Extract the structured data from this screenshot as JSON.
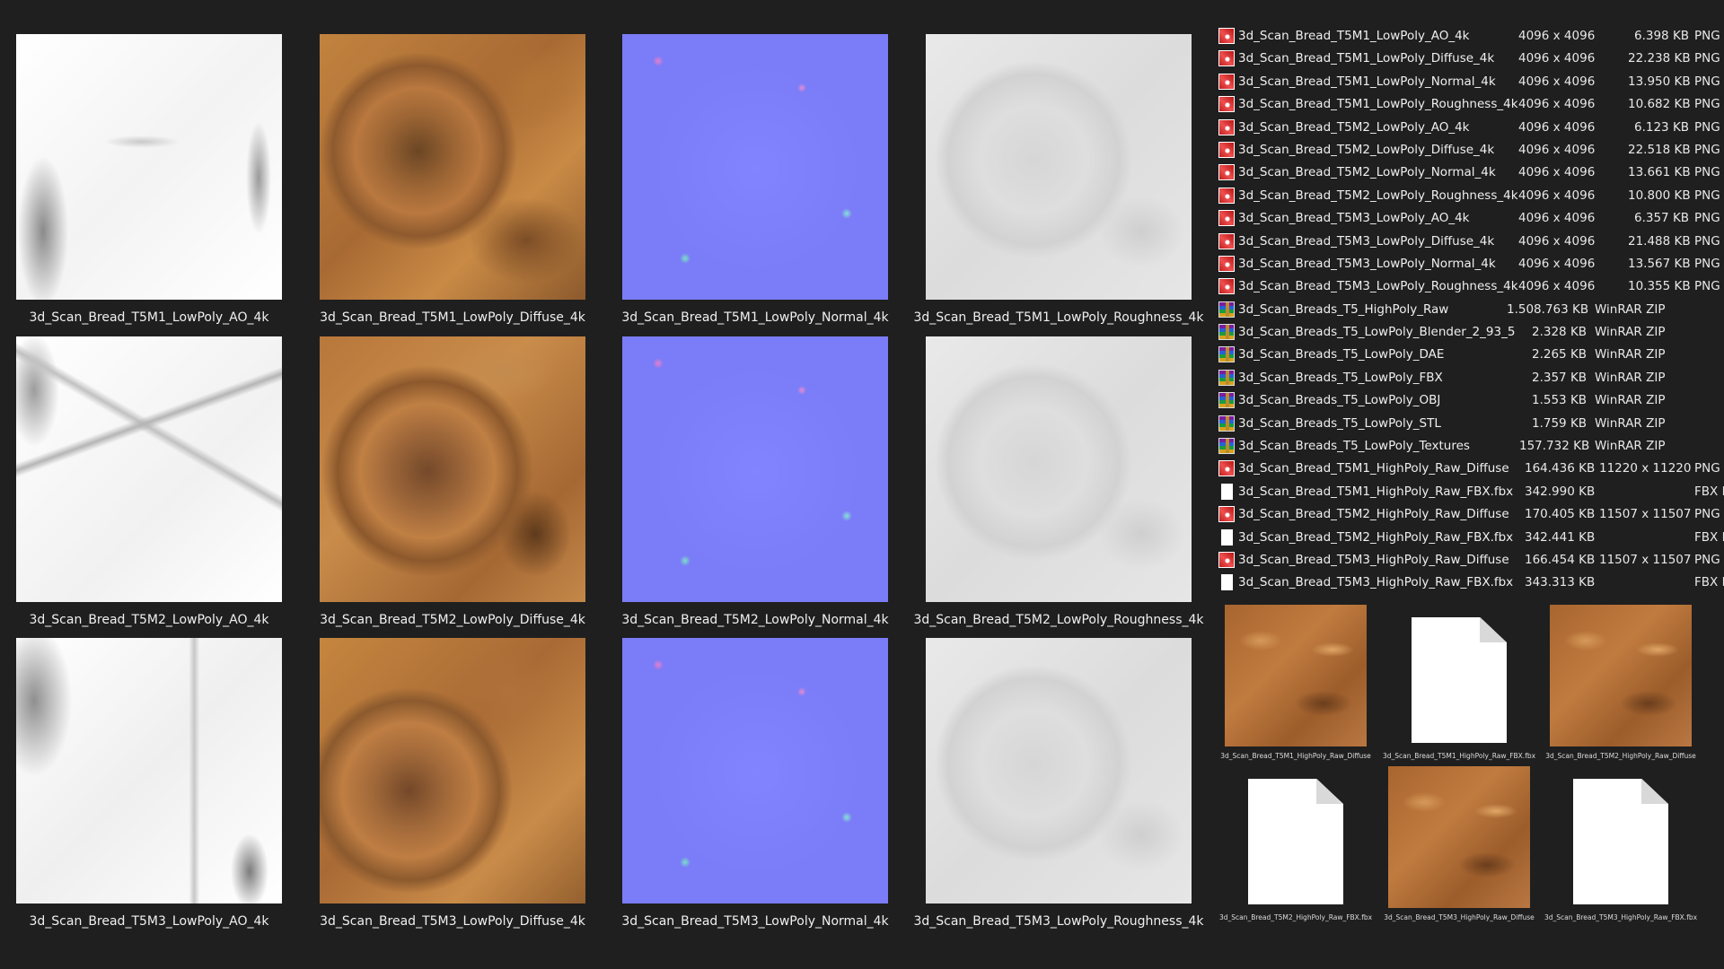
{
  "grid": {
    "tiles": [
      {
        "label": "3d_Scan_Bread_T5M1_LowPoly_AO_4k",
        "kind": "ao"
      },
      {
        "label": "3d_Scan_Bread_T5M1_LowPoly_Diffuse_4k",
        "kind": "diffuse"
      },
      {
        "label": "3d_Scan_Bread_T5M1_LowPoly_Normal_4k",
        "kind": "normal"
      },
      {
        "label": "3d_Scan_Bread_T5M1_LowPoly_Roughness_4k",
        "kind": "roughness"
      },
      {
        "label": "3d_Scan_Bread_T5M2_LowPoly_AO_4k",
        "kind": "ao"
      },
      {
        "label": "3d_Scan_Bread_T5M2_LowPoly_Diffuse_4k",
        "kind": "diffuse"
      },
      {
        "label": "3d_Scan_Bread_T5M2_LowPoly_Normal_4k",
        "kind": "normal"
      },
      {
        "label": "3d_Scan_Bread_T5M2_LowPoly_Roughness_4k",
        "kind": "roughness"
      },
      {
        "label": "3d_Scan_Bread_T5M3_LowPoly_AO_4k",
        "kind": "ao"
      },
      {
        "label": "3d_Scan_Bread_T5M3_LowPoly_Diffuse_4k",
        "kind": "diffuse"
      },
      {
        "label": "3d_Scan_Bread_T5M3_LowPoly_Normal_4k",
        "kind": "normal"
      },
      {
        "label": "3d_Scan_Bread_T5M3_LowPoly_Roughness_4k",
        "kind": "roughness"
      }
    ]
  },
  "file_list": {
    "rows": [
      {
        "name": "3d_Scan_Bread_T5M1_LowPoly_AO_4k",
        "dimensions": "4096 x 4096",
        "size": "6.398 KB",
        "type": "PNG",
        "icon": "png-file-icon"
      },
      {
        "name": "3d_Scan_Bread_T5M1_LowPoly_Diffuse_4k",
        "dimensions": "4096 x 4096",
        "size": "22.238 KB",
        "type": "PNG",
        "icon": "png-file-icon"
      },
      {
        "name": "3d_Scan_Bread_T5M1_LowPoly_Normal_4k",
        "dimensions": "4096 x 4096",
        "size": "13.950 KB",
        "type": "PNG",
        "icon": "png-file-icon"
      },
      {
        "name": "3d_Scan_Bread_T5M1_LowPoly_Roughness_4k",
        "dimensions": "4096 x 4096",
        "size": "10.682 KB",
        "type": "PNG",
        "icon": "png-file-icon"
      },
      {
        "name": "3d_Scan_Bread_T5M2_LowPoly_AO_4k",
        "dimensions": "4096 x 4096",
        "size": "6.123 KB",
        "type": "PNG",
        "icon": "png-file-icon"
      },
      {
        "name": "3d_Scan_Bread_T5M2_LowPoly_Diffuse_4k",
        "dimensions": "4096 x 4096",
        "size": "22.518 KB",
        "type": "PNG",
        "icon": "png-file-icon"
      },
      {
        "name": "3d_Scan_Bread_T5M2_LowPoly_Normal_4k",
        "dimensions": "4096 x 4096",
        "size": "13.661 KB",
        "type": "PNG",
        "icon": "png-file-icon"
      },
      {
        "name": "3d_Scan_Bread_T5M2_LowPoly_Roughness_4k",
        "dimensions": "4096 x 4096",
        "size": "10.800 KB",
        "type": "PNG",
        "icon": "png-file-icon"
      },
      {
        "name": "3d_Scan_Bread_T5M3_LowPoly_AO_4k",
        "dimensions": "4096 x 4096",
        "size": "6.357 KB",
        "type": "PNG",
        "icon": "png-file-icon"
      },
      {
        "name": "3d_Scan_Bread_T5M3_LowPoly_Diffuse_4k",
        "dimensions": "4096 x 4096",
        "size": "21.488 KB",
        "type": "PNG",
        "icon": "png-file-icon"
      },
      {
        "name": "3d_Scan_Bread_T5M3_LowPoly_Normal_4k",
        "dimensions": "4096 x 4096",
        "size": "13.567 KB",
        "type": "PNG",
        "icon": "png-file-icon"
      },
      {
        "name": "3d_Scan_Bread_T5M3_LowPoly_Roughness_4k",
        "dimensions": "4096 x 4096",
        "size": "10.355 KB",
        "type": "PNG",
        "icon": "png-file-icon"
      },
      {
        "name": "3d_Scan_Breads_T5_HighPoly_Raw",
        "size": "1.508.763 KB",
        "type": "WinRAR ZIP",
        "icon": "winrar-archive-icon"
      },
      {
        "name": "3d_Scan_Breads_T5_LowPoly_Blender_2_93_5",
        "size": "2.328 KB",
        "type": "WinRAR ZIP",
        "icon": "winrar-archive-icon"
      },
      {
        "name": "3d_Scan_Breads_T5_LowPoly_DAE",
        "size": "2.265 KB",
        "type": "WinRAR ZIP",
        "icon": "winrar-archive-icon"
      },
      {
        "name": "3d_Scan_Breads_T5_LowPoly_FBX",
        "size": "2.357 KB",
        "type": "WinRAR ZIP",
        "icon": "winrar-archive-icon"
      },
      {
        "name": "3d_Scan_Breads_T5_LowPoly_OBJ",
        "size": "1.553 KB",
        "type": "WinRAR ZIP",
        "icon": "winrar-archive-icon"
      },
      {
        "name": "3d_Scan_Breads_T5_LowPoly_STL",
        "size": "1.759 KB",
        "type": "WinRAR ZIP",
        "icon": "winrar-archive-icon"
      },
      {
        "name": "3d_Scan_Breads_T5_LowPoly_Textures",
        "size": "157.732 KB",
        "type": "WinRAR ZIP",
        "icon": "winrar-archive-icon"
      },
      {
        "name": "3d_Scan_Bread_T5M1_HighPoly_Raw_Diffuse",
        "size": "164.436 KB",
        "dimensions": "11220 x 11220",
        "type": "PNG",
        "icon": "png-file-icon"
      },
      {
        "name": "3d_Scan_Bread_T5M1_HighPoly_Raw_FBX.fbx",
        "size": "342.990 KB",
        "type": "FBX I",
        "icon": "blank-file-icon"
      },
      {
        "name": "3d_Scan_Bread_T5M2_HighPoly_Raw_Diffuse",
        "size": "170.405 KB",
        "dimensions": "11507 x 11507",
        "type": "PNG",
        "icon": "png-file-icon"
      },
      {
        "name": "3d_Scan_Bread_T5M2_HighPoly_Raw_FBX.fbx",
        "size": "342.441 KB",
        "type": "FBX I",
        "icon": "blank-file-icon"
      },
      {
        "name": "3d_Scan_Bread_T5M3_HighPoly_Raw_Diffuse",
        "size": "166.454 KB",
        "dimensions": "11507 x 11507",
        "type": "PNG",
        "icon": "png-file-icon"
      },
      {
        "name": "3d_Scan_Bread_T5M3_HighPoly_Raw_FBX.fbx",
        "size": "343.313 KB",
        "type": "FBX I",
        "icon": "blank-file-icon"
      }
    ]
  },
  "large_icons": {
    "items": [
      {
        "label": "3d_Scan_Bread_T5M1_HighPoly_Raw_Diffuse",
        "kind": "texture"
      },
      {
        "label": "3d_Scan_Bread_T5M1_HighPoly_Raw_FBX.fbx",
        "kind": "document"
      },
      {
        "label": "3d_Scan_Bread_T5M2_HighPoly_Raw_Diffuse",
        "kind": "texture"
      },
      {
        "label": "3d_Scan_Bread_T5M2_HighPoly_Raw_FBX.fbx",
        "kind": "document"
      },
      {
        "label": "3d_Scan_Bread_T5M3_HighPoly_Raw_Diffuse",
        "kind": "texture"
      },
      {
        "label": "3d_Scan_Bread_T5M3_HighPoly_Raw_FBX.fbx",
        "kind": "document"
      }
    ]
  }
}
